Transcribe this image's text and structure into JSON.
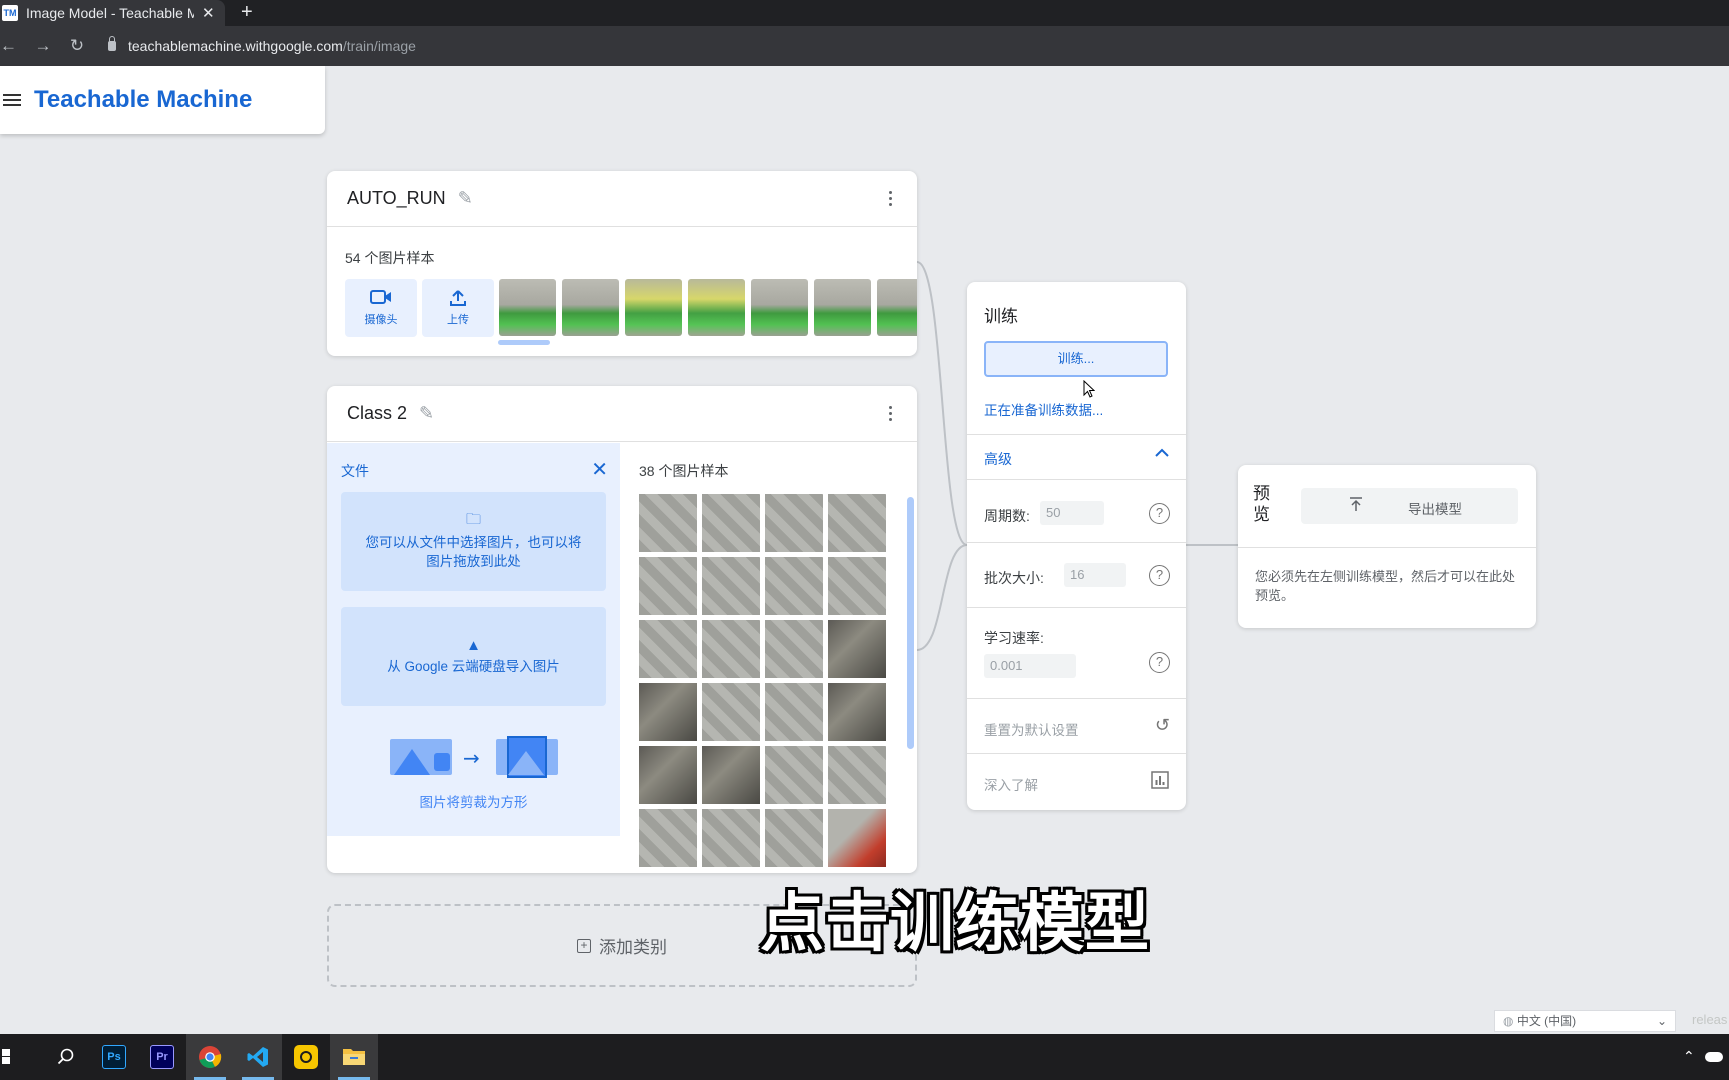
{
  "browser": {
    "tab_title": "Image Model - Teachable Mac",
    "favicon": "TM",
    "url_host": "teachablemachine.withgoogle.com",
    "url_path": "/train/image",
    "new_tab": "+"
  },
  "app": {
    "title": "Teachable Machine"
  },
  "class1": {
    "name": "AUTO_RUN",
    "sample_count": "54 个图片样本",
    "webcam_label": "摄像头",
    "upload_label": "上传"
  },
  "class2": {
    "name": "Class 2",
    "files_title": "文件",
    "choose_files_text": "您可以从文件中选择图片，也可以将图片拖放到此处",
    "drive_text": "从 Google 云端硬盘导入图片",
    "crop_text": "图片将剪裁为方形",
    "sample_count": "38 个图片样本"
  },
  "add_class": {
    "label": "添加类别"
  },
  "training": {
    "title": "训练",
    "train_button": "训练...",
    "status": "正在准备训练数据...",
    "advanced_label": "高级",
    "epochs_label": "周期数:",
    "epochs_value": "50",
    "batch_label": "批次大小:",
    "batch_value": "16",
    "lr_label": "学习速率:",
    "lr_value": "0.001",
    "reset_label": "重置为默认设置",
    "learn_more_label": "深入了解"
  },
  "preview": {
    "title": "预览",
    "export_label": "导出模型",
    "message": "您必须先在左侧训练模型，然后才可以在此处预览。"
  },
  "subtitle": "点击训练模型",
  "footer": {
    "language": "中文 (中国)",
    "release": "releas"
  },
  "taskbar": {
    "apps": [
      {
        "name": "windows-start-icon",
        "label": ""
      },
      {
        "name": "search-icon",
        "label": ""
      },
      {
        "name": "photoshop-icon",
        "label": "Ps",
        "color": "#31a8ff",
        "bg": "#001e36"
      },
      {
        "name": "premiere-icon",
        "label": "Pr",
        "color": "#9999ff",
        "bg": "#00005b"
      },
      {
        "name": "chrome-icon",
        "label": ""
      },
      {
        "name": "vscode-icon",
        "label": ""
      },
      {
        "name": "app-yellow-icon",
        "label": ""
      },
      {
        "name": "file-explorer-icon",
        "label": ""
      }
    ]
  },
  "colors": {
    "accent": "#1967d2",
    "panel_blue": "#e8f0fe",
    "background": "#e8eaed"
  }
}
